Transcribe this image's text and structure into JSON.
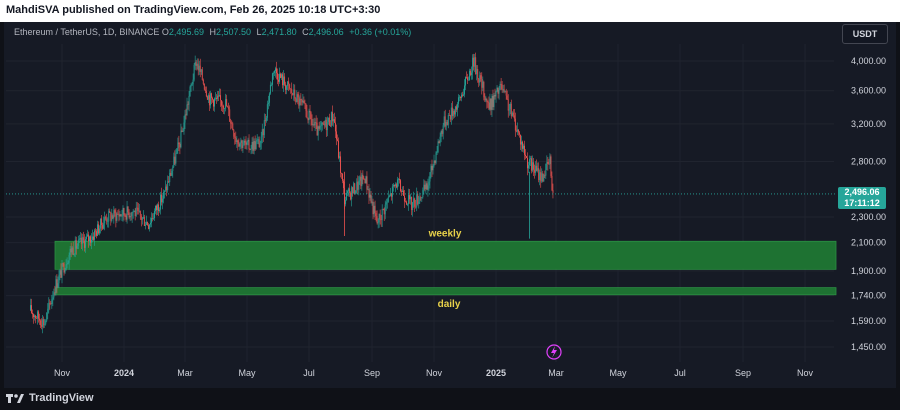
{
  "header": {
    "published_text": "MahdiSVA published on TradingView.com, Feb 26, 2025 10:18 UTC+3:30"
  },
  "legend": {
    "symbol": "Ethereum / TetherUS, 1D, BINANCE",
    "o_key": "O",
    "o_val": "2,495.69",
    "h_key": "H",
    "h_val": "2,507.50",
    "l_key": "L",
    "l_val": "2,471.80",
    "c_key": "C",
    "c_val": "2,496.06",
    "change": "+0.36 (+0.01%)"
  },
  "currency": "USDT",
  "price_tag": {
    "price": "2,496.06",
    "countdown": "17:11:12"
  },
  "footer": {
    "brand": "TradingView"
  },
  "colors": {
    "up": "#26a69a",
    "down": "#ef5350",
    "zone": "#1f7a34",
    "zone_label": "#e9d24a",
    "background": "#161a25"
  },
  "icons": {
    "flash": "lightning-icon",
    "brand": "tradingview-logo"
  },
  "chart_data": {
    "type": "candlestick",
    "symbol": "ETHUSDT",
    "timeframe": "1D",
    "scale": "log",
    "y_ticks": [
      "4,000.00",
      "3,600.00",
      "3,200.00",
      "2,800.00",
      "2,300.00",
      "2,100.00",
      "1,900.00",
      "1,740.00",
      "1,590.00",
      "1,450.00"
    ],
    "y_tick_values": [
      4000,
      3600,
      3200,
      2800,
      2300,
      2100,
      1900,
      1740,
      1590,
      1450
    ],
    "x_ticks": [
      "Nov",
      "2024",
      "Mar",
      "May",
      "Jul",
      "Sep",
      "Nov",
      "2025",
      "Mar",
      "May",
      "Jul",
      "Sep",
      "Nov"
    ],
    "x_tick_dates": [
      "2023-11",
      "2024-01",
      "2024-03",
      "2024-05",
      "2024-07",
      "2024-09",
      "2024-11",
      "2025-01",
      "2025-03",
      "2025-05",
      "2025-07",
      "2025-09",
      "2025-11"
    ],
    "last_price": 2496.06,
    "price_path": [
      [
        "2023-10-01",
        1650
      ],
      [
        "2023-10-15",
        1580
      ],
      [
        "2023-10-25",
        1800
      ],
      [
        "2023-11-10",
        2050
      ],
      [
        "2023-12-01",
        2150
      ],
      [
        "2023-12-15",
        2300
      ],
      [
        "2024-01-10",
        2350
      ],
      [
        "2024-01-25",
        2250
      ],
      [
        "2024-02-10",
        2500
      ],
      [
        "2024-02-25",
        3000
      ],
      [
        "2024-03-12",
        4000
      ],
      [
        "2024-03-25",
        3500
      ],
      [
        "2024-04-10",
        3450
      ],
      [
        "2024-04-20",
        3050
      ],
      [
        "2024-05-01",
        2950
      ],
      [
        "2024-05-15",
        3000
      ],
      [
        "2024-05-27",
        3900
      ],
      [
        "2024-06-10",
        3650
      ],
      [
        "2024-06-25",
        3400
      ],
      [
        "2024-07-10",
        3100
      ],
      [
        "2024-07-25",
        3300
      ],
      [
        "2024-08-05",
        2450
      ],
      [
        "2024-08-25",
        2650
      ],
      [
        "2024-09-06",
        2250
      ],
      [
        "2024-09-25",
        2600
      ],
      [
        "2024-10-10",
        2400
      ],
      [
        "2024-10-25",
        2550
      ],
      [
        "2024-11-10",
        3200
      ],
      [
        "2024-11-25",
        3450
      ],
      [
        "2024-12-10",
        4000
      ],
      [
        "2024-12-25",
        3400
      ],
      [
        "2025-01-06",
        3650
      ],
      [
        "2025-01-20",
        3200
      ],
      [
        "2025-02-01",
        2800
      ],
      [
        "2025-02-15",
        2650
      ],
      [
        "2025-02-23",
        2800
      ],
      [
        "2025-02-26",
        2496.06
      ]
    ],
    "zones": [
      {
        "label": "weekly",
        "low": 1910,
        "high": 2110
      },
      {
        "label": "daily",
        "low": 1745,
        "high": 1790
      }
    ]
  }
}
